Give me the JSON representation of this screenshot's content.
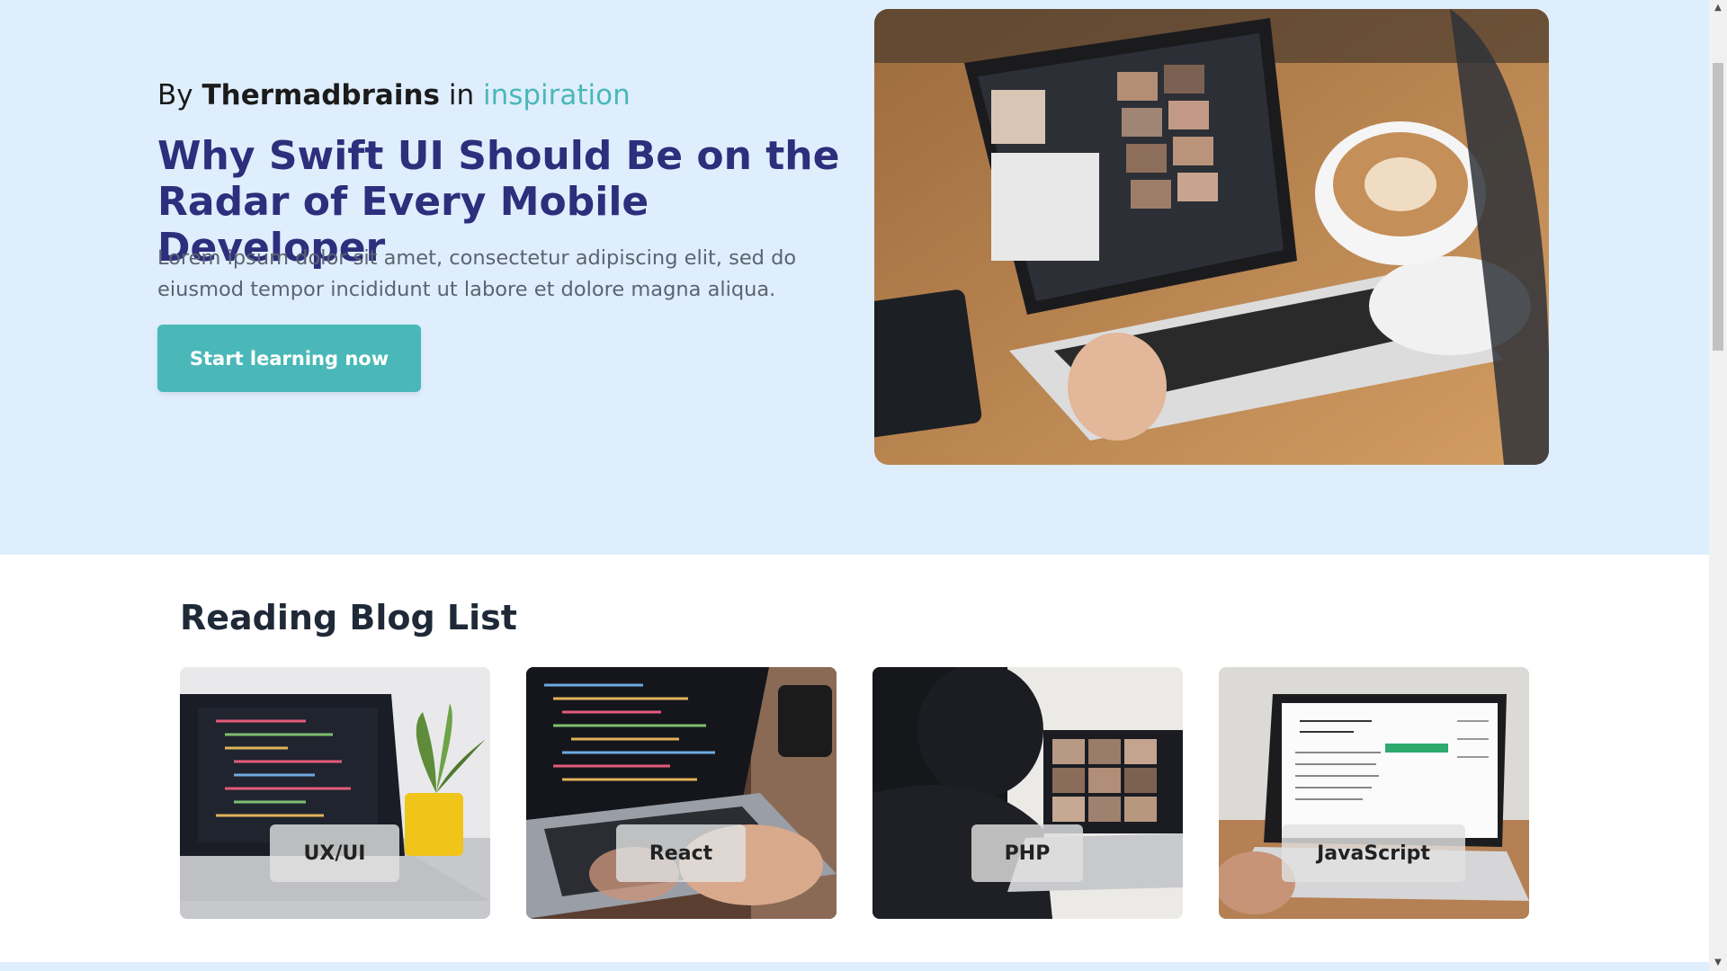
{
  "hero": {
    "byline_prefix": "By",
    "author": "Thermadbrains",
    "byline_in": "in",
    "category": "inspiration",
    "title": "Why Swift UI Should Be on the Radar of Every Mobile Developer",
    "description": "Lorem ipsum dolor sit amet, consectetur adipiscing elit, sed do eiusmod tempor incididunt ut labore et dolore magna aliqua.",
    "cta_label": "Start learning now",
    "image_icon": "laptop-video-call-photo"
  },
  "blog_list": {
    "title": "Reading Blog List",
    "cards": [
      {
        "label": "UX/UI",
        "image_icon": "laptop-code-plant-photo"
      },
      {
        "label": "React",
        "image_icon": "laptop-code-typing-photo"
      },
      {
        "label": "PHP",
        "image_icon": "person-video-call-photo"
      },
      {
        "label": "JavaScript",
        "image_icon": "laptop-document-photo"
      }
    ]
  },
  "colors": {
    "hero_background": "#dfeefd",
    "accent_teal": "#4ab8b8",
    "title_navy": "#2d2e7c",
    "body_gray": "#5b6470"
  }
}
